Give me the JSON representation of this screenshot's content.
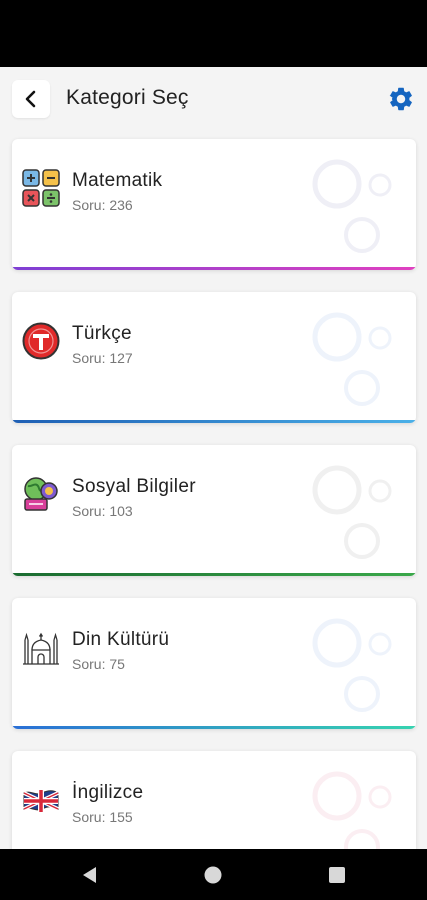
{
  "header": {
    "title": "Kategori Seç",
    "back_icon": "chevron-left-icon",
    "settings_icon": "gear-icon",
    "accent": "#1565c0"
  },
  "categories": [
    {
      "name": "Matematik",
      "count": "Soru: 236",
      "icon": "calculator-icon",
      "bar": [
        "#7e3fd4",
        "#e040c0"
      ],
      "deco": "#efeff6"
    },
    {
      "name": "Türkçe",
      "count": "Soru: 127",
      "icon": "letter-t-icon",
      "bar": [
        "#1e5fb4",
        "#4ab0e8"
      ],
      "deco": "#eef3fb"
    },
    {
      "name": "Sosyal Bilgiler",
      "count": "Soru: 103",
      "icon": "globe-badges-icon",
      "bar": [
        "#1a6b30",
        "#3aa84a"
      ],
      "deco": "#f0f0f0"
    },
    {
      "name": "Din Kültürü",
      "count": "Soru: 75",
      "icon": "mosque-icon",
      "bar": [
        "#2a6fd6",
        "#36d3b0"
      ],
      "deco": "#eef3fb"
    },
    {
      "name": "İngilizce",
      "count": "Soru: 155",
      "icon": "uk-flag-icon",
      "bar": [
        "#d04060",
        "#ff80a0"
      ],
      "deco": "#fbeef2"
    }
  ],
  "navbar": {
    "back": "triangle-back-icon",
    "home": "circle-home-icon",
    "recents": "square-recents-icon"
  }
}
